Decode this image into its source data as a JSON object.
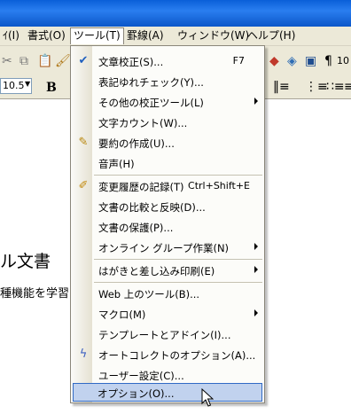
{
  "menubar": {
    "items": [
      {
        "label": "ｲ(I)"
      },
      {
        "label": "書式(O)"
      },
      {
        "label": "ツール(T)"
      },
      {
        "label": "罫線(A)"
      },
      {
        "label": "ウィンドウ(W)"
      },
      {
        "label": "ヘルプ(H)"
      }
    ]
  },
  "toolbar": {
    "font_size": "10.5",
    "bold_label": "B",
    "zoom_partial": "10"
  },
  "document": {
    "heading": "ル文書",
    "body_line": "種機能を学習"
  },
  "tools_menu": {
    "items": [
      {
        "label": "文章校正(S)...",
        "shortcut": "F7",
        "icon": "spellcheck-icon"
      },
      {
        "label": "表記ゆれチェック(Y)..."
      },
      {
        "label": "その他の校正ツール(L)",
        "submenu": true
      },
      {
        "label": "文字カウント(W)..."
      },
      {
        "label": "要約の作成(U)...",
        "icon": "summarize-icon"
      },
      {
        "label": "音声(H)"
      },
      {
        "label": "変更履歴の記録(T)",
        "shortcut": "Ctrl+Shift+E",
        "icon": "track-changes-icon"
      },
      {
        "label": "文書の比較と反映(D)..."
      },
      {
        "label": "文書の保護(P)..."
      },
      {
        "label": "オンライン グループ作業(N)",
        "submenu": true
      },
      {
        "label": "はがきと差し込み印刷(E)",
        "submenu": true
      },
      {
        "label": "Web 上のツール(B)..."
      },
      {
        "label": "マクロ(M)",
        "submenu": true
      },
      {
        "label": "テンプレートとアドイン(I)..."
      },
      {
        "label": "オートコレクトのオプション(A)...",
        "icon": "autocorrect-icon"
      },
      {
        "label": "ユーザー設定(C)..."
      },
      {
        "label": "オプション(O)...",
        "highlighted": true
      }
    ]
  },
  "colors": {
    "menu_bg": "#ece9d8",
    "highlight": "#c1d2ee",
    "highlight_border": "#316ac5"
  }
}
